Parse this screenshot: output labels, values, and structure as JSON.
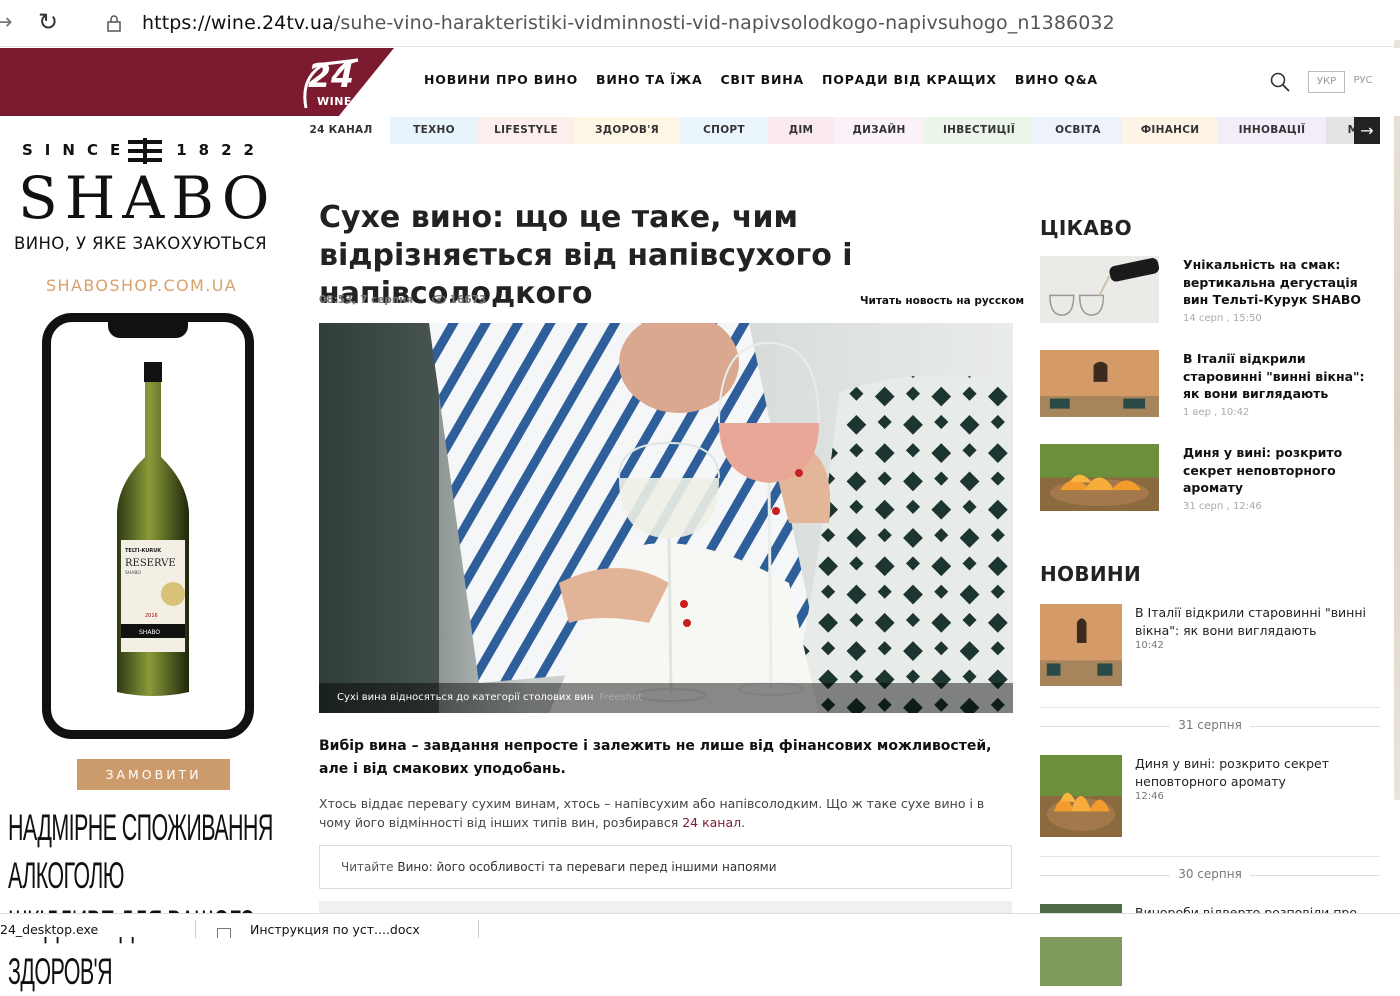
{
  "browser": {
    "url_prefix": "https://wine.24tv.ua",
    "url_path": "/suhe-vino-harakteristiki-vidminnosti-vid-napivsolodkogo-napivsuhogo_n1386032"
  },
  "header": {
    "logo_number": "24",
    "logo_word": "WINE",
    "nav": [
      "НОВИНИ ПРО ВИНО",
      "ВИНО ТА ЇЖА",
      "СВІТ ВИНА",
      "ПОРАДИ ВІД КРАЩИХ",
      "ВИНО Q&A"
    ],
    "lang_ukr": "УКР",
    "lang_rus": "РУС"
  },
  "categories": [
    {
      "label": "24 КАНАЛ",
      "bg": "#ffffff",
      "w": 98
    },
    {
      "label": "ТЕХНО",
      "bg": "#e8f4fb",
      "w": 88
    },
    {
      "label": "LIFESTYLE",
      "bg": "#fdeeee",
      "w": 96
    },
    {
      "label": "ЗДОРОВ'Я",
      "bg": "#fff7e6",
      "w": 106
    },
    {
      "label": "СПОРТ",
      "bg": "#eaf6fb",
      "w": 88
    },
    {
      "label": "ДІМ",
      "bg": "#fbe9f1",
      "w": 66
    },
    {
      "label": "ДИЗАЙН",
      "bg": "#fbf1f8",
      "w": 90
    },
    {
      "label": "ІНВЕСТИЦІЇ",
      "bg": "#ebf5ea",
      "w": 110
    },
    {
      "label": "ОСВІТА",
      "bg": "#eef3fb",
      "w": 88
    },
    {
      "label": "ФІНАНСИ",
      "bg": "#fdf4e6",
      "w": 96
    },
    {
      "label": "ІННОВАЦІЇ",
      "bg": "#f2edf8",
      "w": 108
    },
    {
      "label": "М",
      "bg": "#e4e4e4",
      "w": 54
    }
  ],
  "ad": {
    "since": "SINCE",
    "year": "1822",
    "brand": "SHABO",
    "tagline": "ВИНО, У ЯКЕ ЗАКОХУЮТЬСЯ",
    "shop": "SHABOSHOP.COM.UA",
    "bottle_brand": "TELTI-KURUK",
    "bottle_line": "RESERVE",
    "bottle_maker": "SHABO",
    "bottle_year": "2016",
    "order_button": "ЗАМОВИТИ",
    "warning_line1": "НАДМІРНЕ СПОЖИВАННЯ АЛКОГОЛЮ",
    "warning_line2": "ШКІДЛИВЕ ДЛЯ ВАШОГО ЗДОРОВ'Я"
  },
  "article": {
    "title": "Сухе вино: що це таке, чим відрізняється від напівсухого і напівсолодкого",
    "date": "08:53, 7 серпня",
    "views": "16673",
    "ru_link": "Читать новость на русском",
    "caption": "Сухі вина відносяться до категорії столових вин",
    "caption_source": "Freeshot",
    "lead": "Вибір вина – завдання непросте і залежить не лише від фінансових можливостей, але і від смакових уподобань.",
    "body_text": "Хтось віддає перевагу сухим винам, хтось – напівсухим або напівсолодким. Що ж таке сухе вино і в чому його відмінності від інших типів вин, розбирався ",
    "body_link": "24 канал",
    "body_end": ".",
    "read_also_prefix": "Читайте",
    "read_also_title": "Вино: його особливості та переваги перед іншими напоями"
  },
  "sidebar": {
    "interesting_title": "ЦІКАВО",
    "interesting": [
      {
        "title": "Унікальність на смак: вертикальна дегустація вин Тельті-Курук SHABO",
        "date": "14 серп , 15:50",
        "thumb": "wine-pour"
      },
      {
        "title": "В Італії відкрили старовинні \"винні вікна\": як вони виглядають",
        "date": "1 вер , 10:42",
        "thumb": "window"
      },
      {
        "title": "Диня у вині: розкрито секрет неповторного аромату",
        "date": "31 серп , 12:46",
        "thumb": "melon"
      }
    ],
    "news_title": "НОВИНИ",
    "news": [
      {
        "title": "В Італії відкрили старовинні \"винні вікна\": як вони виглядають",
        "time": "10:42",
        "thumb": "window"
      },
      {
        "title": "Диня у вині: розкрито секрет неповторного аромату",
        "time": "12:46",
        "thumb": "melon"
      },
      {
        "title": "Винороби відверто розповіли про",
        "time": "",
        "thumb": "other"
      }
    ],
    "date_sep_1": "31 серпня",
    "date_sep_2": "30 серпня"
  },
  "downloads": {
    "file1": "24_desktop.exe",
    "file2": "Инструкция по уст....docx"
  }
}
